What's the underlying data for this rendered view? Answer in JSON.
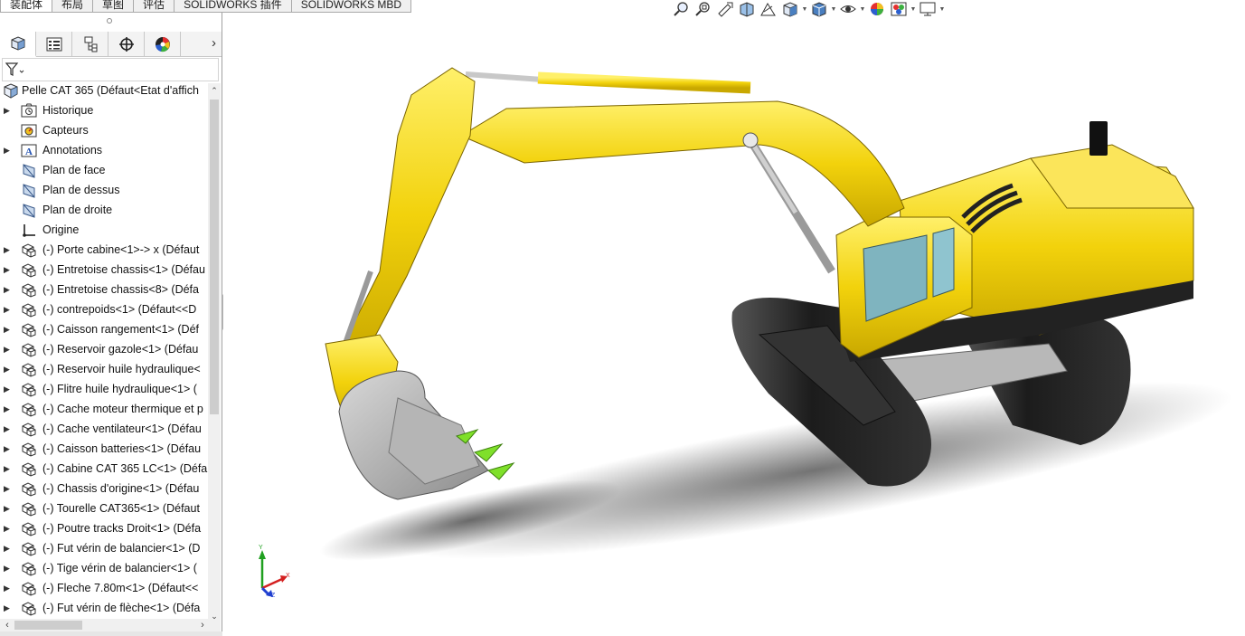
{
  "command_tabs": [
    "装配体",
    "布局",
    "草图",
    "评估",
    "SOLIDWORKS 插件",
    "SOLIDWORKS MBD"
  ],
  "panel_tabs": [
    {
      "icon": "assembly-feature-manager-icon"
    },
    {
      "icon": "property-manager-icon"
    },
    {
      "icon": "configuration-manager-icon"
    },
    {
      "icon": "dimxpert-icon"
    },
    {
      "icon": "display-manager-icon"
    }
  ],
  "tree": {
    "root": "Pelle CAT 365  (Défaut<Etat d'affich",
    "items": [
      {
        "label": "Historique",
        "icon": "history-folder-icon",
        "expandable": true
      },
      {
        "label": "Capteurs",
        "icon": "sensors-icon",
        "expandable": false
      },
      {
        "label": "Annotations",
        "icon": "annotations-icon",
        "expandable": true
      },
      {
        "label": "Plan de face",
        "icon": "plane-icon",
        "expandable": false
      },
      {
        "label": "Plan de dessus",
        "icon": "plane-icon",
        "expandable": false
      },
      {
        "label": "Plan de droite",
        "icon": "plane-icon",
        "expandable": false
      },
      {
        "label": "Origine",
        "icon": "origin-icon",
        "expandable": false
      },
      {
        "label": "(-) Porte cabine<1>-> x (Défaut",
        "icon": "part-icon",
        "expandable": true
      },
      {
        "label": "(-) Entretoise chassis<1> (Défau",
        "icon": "part-icon",
        "expandable": true
      },
      {
        "label": "(-) Entretoise chassis<8> (Défa",
        "icon": "part-icon",
        "expandable": true
      },
      {
        "label": "(-) contrepoids<1> (Défaut<<D",
        "icon": "part-icon",
        "expandable": true
      },
      {
        "label": "(-) Caisson rangement<1> (Déf",
        "icon": "part-icon",
        "expandable": true
      },
      {
        "label": "(-) Reservoir gazole<1> (Défau",
        "icon": "part-icon",
        "expandable": true
      },
      {
        "label": "(-) Reservoir huile hydraulique<",
        "icon": "part-icon",
        "expandable": true
      },
      {
        "label": "(-) Flitre huile hydraulique<1> (",
        "icon": "part-icon",
        "expandable": true
      },
      {
        "label": "(-) Cache moteur thermique et p",
        "icon": "part-icon",
        "expandable": true
      },
      {
        "label": "(-) Cache ventilateur<1> (Défau",
        "icon": "part-icon",
        "expandable": true
      },
      {
        "label": "(-) Caisson batteries<1> (Défau",
        "icon": "part-icon",
        "expandable": true
      },
      {
        "label": "(-) Cabine CAT 365 LC<1> (Défa",
        "icon": "part-icon",
        "expandable": true
      },
      {
        "label": "(-) Chassis d'origine<1> (Défau",
        "icon": "part-icon",
        "expandable": true
      },
      {
        "label": "(-) Tourelle CAT365<1> (Défaut",
        "icon": "part-icon",
        "expandable": true
      },
      {
        "label": "(-) Poutre tracks Droit<1> (Défa",
        "icon": "part-icon",
        "expandable": true
      },
      {
        "label": "(-) Fut vérin de balancier<1> (D",
        "icon": "part-icon",
        "expandable": true
      },
      {
        "label": "(-) Tige vérin de balancier<1> (",
        "icon": "part-icon",
        "expandable": true
      },
      {
        "label": "(-) Fleche 7.80m<1> (Défaut<<",
        "icon": "part-icon",
        "expandable": true
      },
      {
        "label": "(-) Fut vérin de flèche<1> (Défa",
        "icon": "part-icon",
        "expandable": true
      }
    ]
  },
  "hud_icons": [
    "zoom-to-fit-icon",
    "zoom-to-area-icon",
    "previous-view-icon",
    "section-view-icon",
    "dynamic-annotation-views-icon",
    "view-orientation-icon",
    "display-style-icon",
    "hide-show-items-icon",
    "edit-appearance-icon",
    "apply-scene-icon",
    "view-settings-icon"
  ],
  "triad": {
    "x": "X",
    "y": "Y",
    "z": "Z"
  },
  "colors": {
    "excavator_yellow": "#f2d20c",
    "track_black": "#1c1c1c",
    "bucket_grey": "#a8a8a8",
    "teeth_green": "#7fe02a",
    "axis_x": "#d42020",
    "axis_y": "#20a020",
    "axis_z": "#2040d0"
  }
}
